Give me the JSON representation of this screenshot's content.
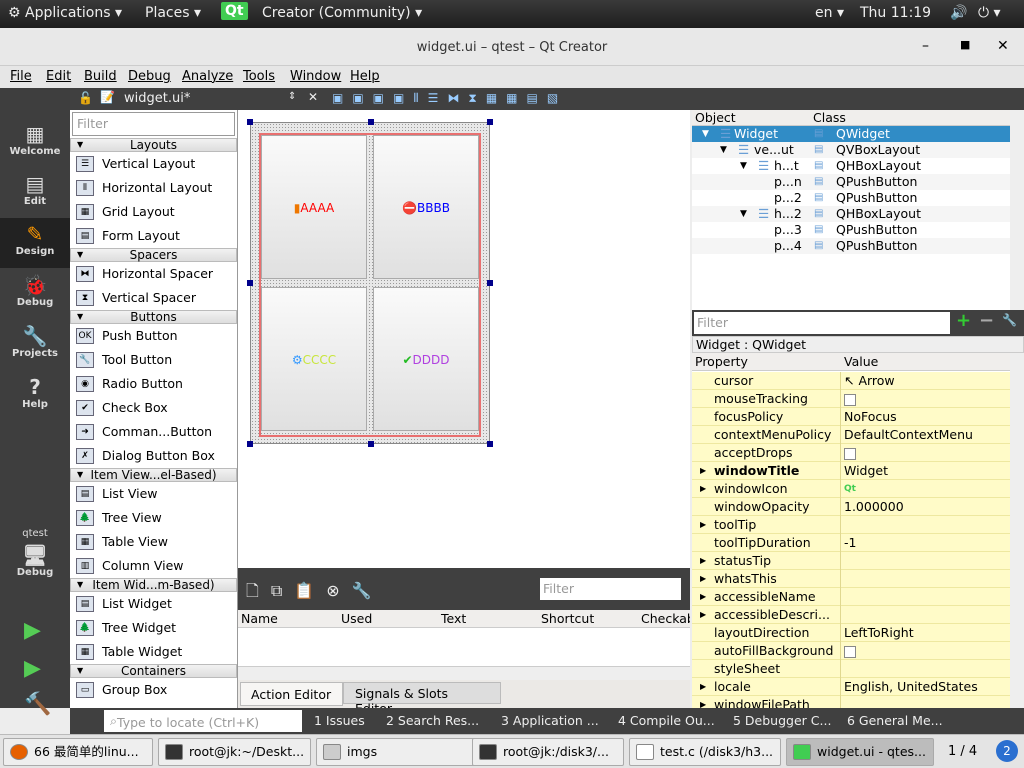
{
  "topbar": {
    "applications": "Applications",
    "places": "Places",
    "app": "Creator (Community)",
    "lang": "en",
    "time": "Thu 11:19"
  },
  "window": {
    "title": "widget.ui – qtest – Qt Creator"
  },
  "menu": [
    "File",
    "Edit",
    "Build",
    "Debug",
    "Analyze",
    "Tools",
    "Window",
    "Help"
  ],
  "editor": {
    "file": "widget.ui*"
  },
  "modes": [
    {
      "label": "Welcome"
    },
    {
      "label": "Edit"
    },
    {
      "label": "Design"
    },
    {
      "label": "Debug"
    },
    {
      "label": "Projects"
    },
    {
      "label": "Help"
    }
  ],
  "kit": {
    "project": "qtest",
    "mode": "Debug"
  },
  "widgetbox": {
    "filter_placeholder": "Filter",
    "groups": [
      {
        "title": "Layouts",
        "items": [
          "Vertical Layout",
          "Horizontal Layout",
          "Grid Layout",
          "Form Layout"
        ]
      },
      {
        "title": "Spacers",
        "items": [
          "Horizontal Spacer",
          "Vertical Spacer"
        ]
      },
      {
        "title": "Buttons",
        "items": [
          "Push Button",
          "Tool Button",
          "Radio Button",
          "Check Box",
          "Comman...Button",
          "Dialog Button Box"
        ]
      },
      {
        "title": "Item View...el-Based)",
        "items": [
          "List View",
          "Tree View",
          "Table View",
          "Column View"
        ]
      },
      {
        "title": "Item Wid...m-Based)",
        "items": [
          "List Widget",
          "Tree Widget",
          "Table Widget"
        ]
      },
      {
        "title": "Containers",
        "items": [
          "Group Box"
        ]
      }
    ]
  },
  "form": {
    "buttons": [
      {
        "text": "AAAA",
        "color": "#ff0000"
      },
      {
        "text": "BBBB",
        "color": "#0000ff"
      },
      {
        "text": "CCCC",
        "color": "#c8e63c"
      },
      {
        "text": "DDDD",
        "color": "#b040e0"
      }
    ]
  },
  "action_editor": {
    "filter_placeholder": "Filter",
    "columns": [
      "Name",
      "Used",
      "Text",
      "Shortcut",
      "Checkable"
    ],
    "tabs": [
      "Action Editor",
      "Signals & Slots Editor"
    ]
  },
  "object_inspector": {
    "columns": [
      "Object",
      "Class"
    ],
    "rows": [
      {
        "object": "Widget",
        "class": "QWidget"
      },
      {
        "object": "ve...ut",
        "class": "QVBoxLayout"
      },
      {
        "object": "h...t",
        "class": "QHBoxLayout"
      },
      {
        "object": "p...n",
        "class": "QPushButton"
      },
      {
        "object": "p...2",
        "class": "QPushButton"
      },
      {
        "object": "h...2",
        "class": "QHBoxLayout"
      },
      {
        "object": "p...3",
        "class": "QPushButton"
      },
      {
        "object": "p...4",
        "class": "QPushButton"
      }
    ]
  },
  "property_editor": {
    "filter_placeholder": "Filter",
    "context": "Widget : QWidget",
    "columns": [
      "Property",
      "Value"
    ],
    "rows": [
      {
        "name": "cursor",
        "value": "Arrow"
      },
      {
        "name": "mouseTracking",
        "value": ""
      },
      {
        "name": "focusPolicy",
        "value": "NoFocus"
      },
      {
        "name": "contextMenuPolicy",
        "value": "DefaultContextMenu"
      },
      {
        "name": "acceptDrops",
        "value": ""
      },
      {
        "name": "windowTitle",
        "value": "Widget"
      },
      {
        "name": "windowIcon",
        "value": ""
      },
      {
        "name": "windowOpacity",
        "value": "1.000000"
      },
      {
        "name": "toolTip",
        "value": ""
      },
      {
        "name": "toolTipDuration",
        "value": "-1"
      },
      {
        "name": "statusTip",
        "value": ""
      },
      {
        "name": "whatsThis",
        "value": ""
      },
      {
        "name": "accessibleName",
        "value": ""
      },
      {
        "name": "accessibleDescri...",
        "value": ""
      },
      {
        "name": "layoutDirection",
        "value": "LeftToRight"
      },
      {
        "name": "autoFillBackground",
        "value": ""
      },
      {
        "name": "styleSheet",
        "value": ""
      },
      {
        "name": "locale",
        "value": "English, UnitedStates"
      },
      {
        "name": "windowFilePath",
        "value": ""
      }
    ]
  },
  "outputbar": {
    "locate_placeholder": "Type to locate (Ctrl+K)",
    "panes": [
      "1  Issues",
      "2  Search Res...",
      "3  Application ...",
      "4  Compile Ou...",
      "5  Debugger C...",
      "6  General Me..."
    ]
  },
  "taskbar": {
    "tasks": [
      "66 最简单的linu...",
      "root@jk:~/Deskt...",
      "imgs",
      "root@jk:/disk3/...",
      "test.c (/disk3/h3...",
      "widget.ui - qtes..."
    ],
    "pager": "1 / 4",
    "badge": "2"
  }
}
